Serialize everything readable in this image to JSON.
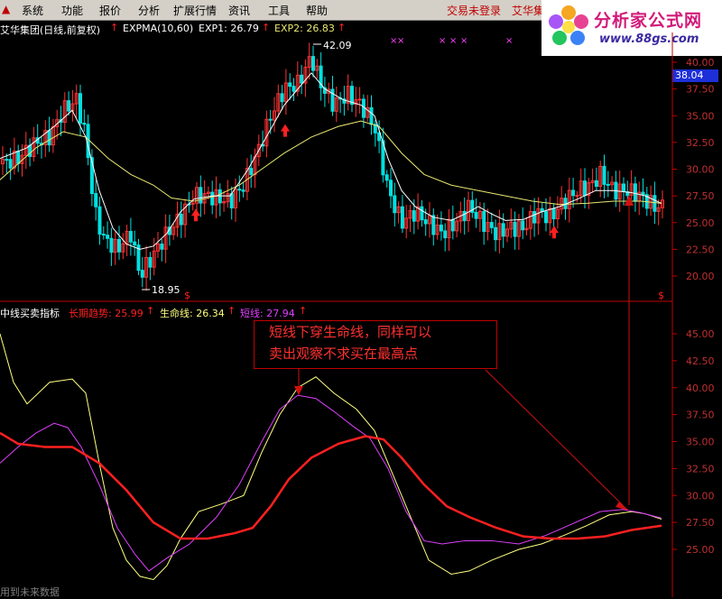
{
  "menu": {
    "items": [
      "系统",
      "功能",
      "报价",
      "分析",
      "扩展行情",
      "资讯",
      "工具",
      "帮助"
    ],
    "trade_status": "交易未登录",
    "stock_short": "艾华集"
  },
  "logo": {
    "brand": "分析家公式网",
    "url": "www.88gs.com"
  },
  "top_panel": {
    "stock_title": "艾华集团(日线,前复权)",
    "indicator": "EXPMA(10,60)",
    "exp1_label": "EXP1: 26.79",
    "exp2_label": "EXP2: 26.83",
    "high_label": "42.09",
    "low_label": "18.95",
    "current_price": "38.04",
    "y_ticks": [
      "40.00",
      "37.50",
      "35.00",
      "32.50",
      "30.00",
      "27.50",
      "25.00",
      "22.50",
      "20.00"
    ],
    "colors": {
      "up": "#ff3232",
      "down": "#00e0e0",
      "exp1": "#ffffff",
      "exp2": "#e8e870",
      "signal_arrow": "#ff2020",
      "dots": "#ff40ff"
    }
  },
  "bottom_panel": {
    "title": "中线买卖指标",
    "long_trend": "长期趋势: 25.99",
    "life_line": "生命线: 26.34",
    "short_line": "短线: 27.94",
    "y_ticks": [
      "45.00",
      "42.50",
      "40.00",
      "37.50",
      "35.00",
      "32.50",
      "30.00",
      "27.50",
      "25.00"
    ],
    "colors": {
      "long_trend": "#ff2020",
      "life_line": "#ffff80",
      "short_line": "#e040ff"
    }
  },
  "annotation": {
    "line1": "短线下穿生命线，同样可以",
    "line2": "卖出观察不求买在最高点"
  },
  "footer": {
    "text": "用到未来数据"
  }
}
